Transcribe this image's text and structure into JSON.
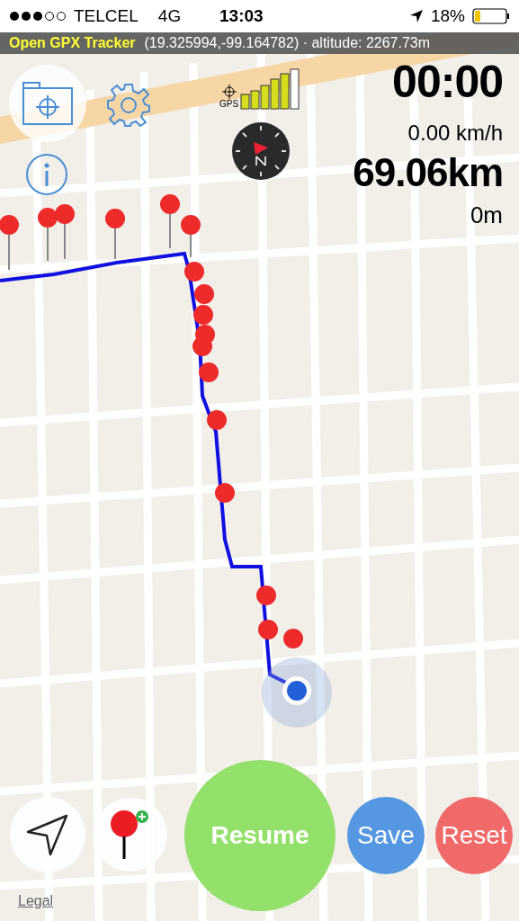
{
  "status_bar": {
    "carrier": "TELCEL",
    "network": "4G",
    "time": "13:03",
    "battery": "18%"
  },
  "info_bar": {
    "app_name": "Open GPX Tracker",
    "location": "(19.325994,-99.164782) · altitude: 2267.73m"
  },
  "gps": {
    "label": "GPS"
  },
  "stats": {
    "timer": "00:00",
    "speed": "0.00 km/h",
    "distance": "69.06km",
    "elevation": "0m"
  },
  "buttons": [
    {
      "kind": "primary",
      "label": "Resume"
    },
    {
      "kind": "save",
      "label": "Save"
    },
    {
      "kind": "reset",
      "label": "Reset"
    }
  ],
  "legal": "Legal"
}
